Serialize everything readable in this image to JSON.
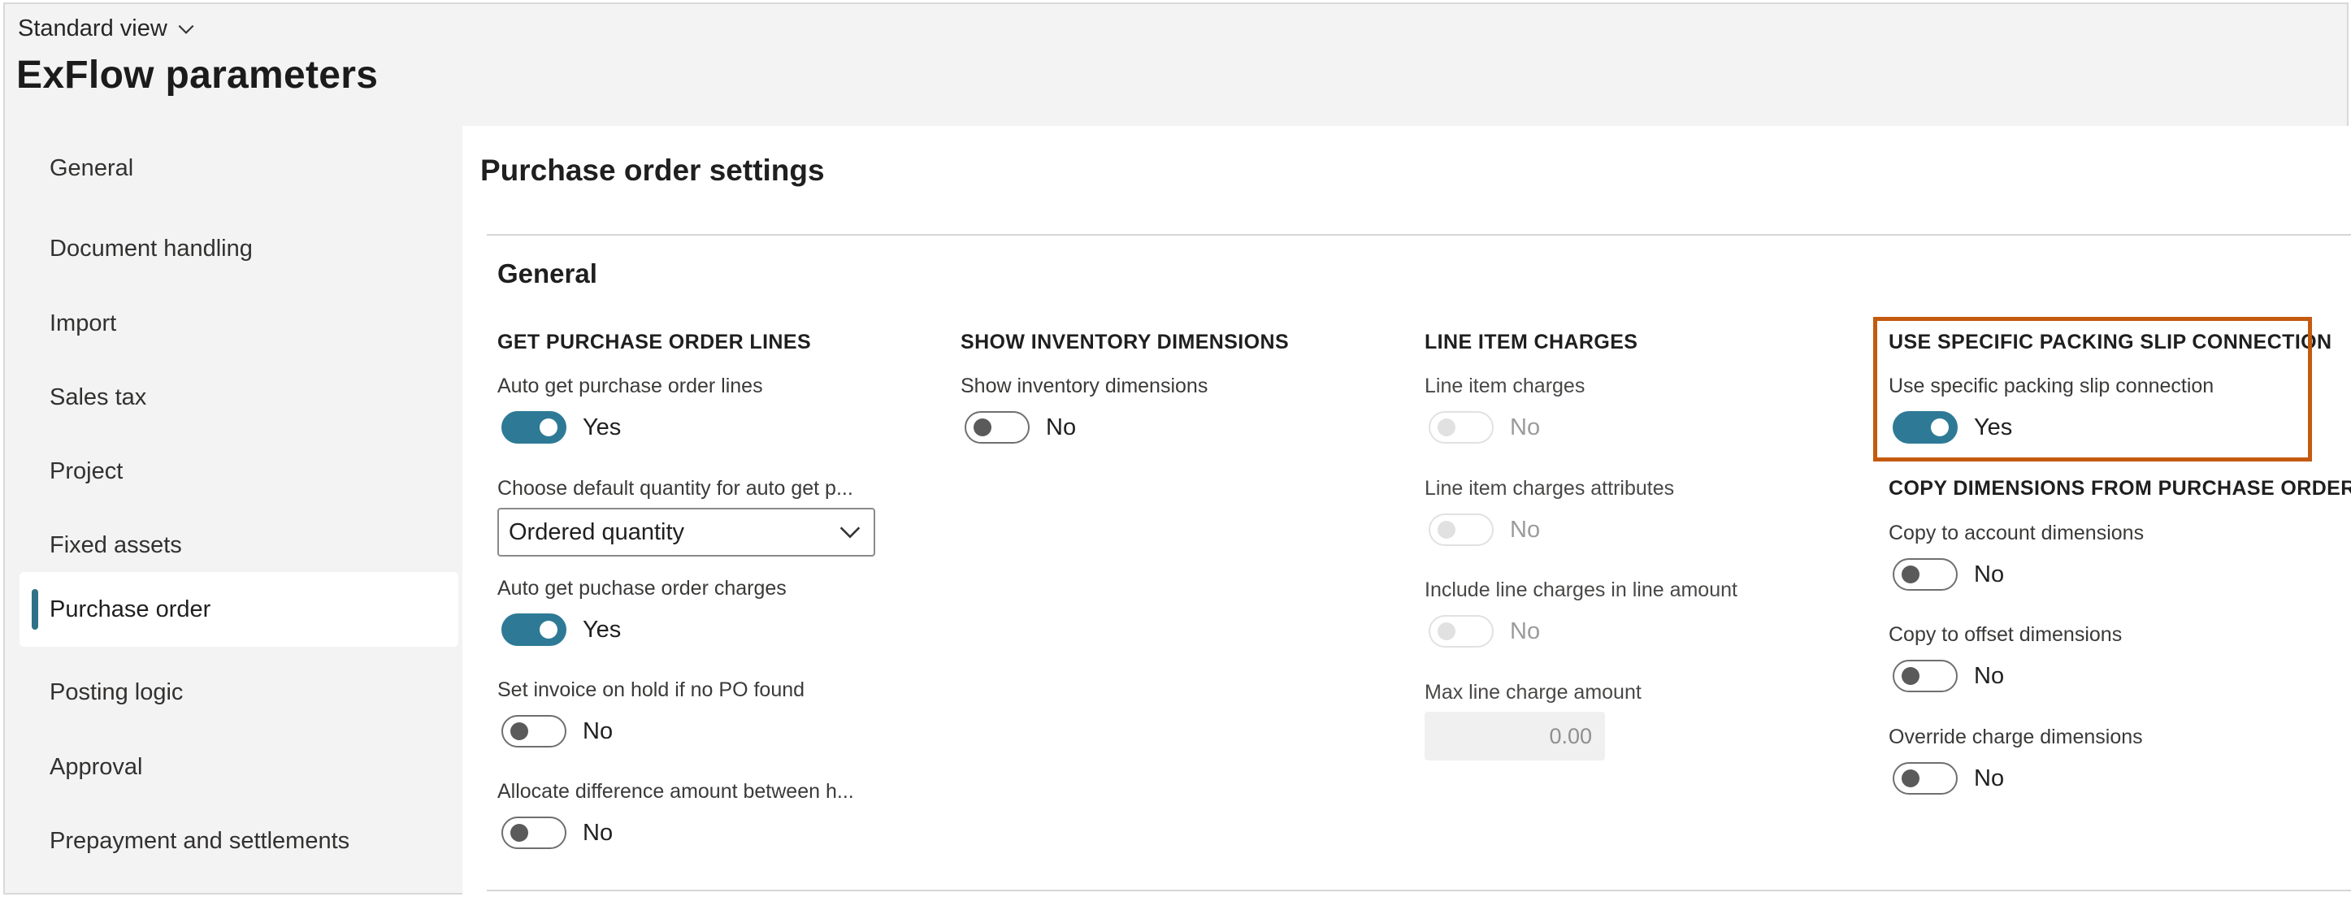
{
  "header": {
    "view_label": "Standard view",
    "page_title": "ExFlow parameters"
  },
  "sidebar": {
    "items": [
      {
        "label": "General"
      },
      {
        "label": "Document handling"
      },
      {
        "label": "Import"
      },
      {
        "label": "Sales tax"
      },
      {
        "label": "Project"
      },
      {
        "label": "Fixed assets"
      },
      {
        "label": "Purchase order"
      },
      {
        "label": "Posting logic"
      },
      {
        "label": "Approval"
      },
      {
        "label": "Prepayment and settlements"
      }
    ],
    "active_index": 6
  },
  "main": {
    "section_title": "Purchase order settings",
    "group_title": "General",
    "col1": {
      "heading": "GET PURCHASE ORDER LINES",
      "auto_get_lines_label": "Auto get purchase order lines",
      "auto_get_lines_value": "Yes",
      "default_qty_label": "Choose default quantity for auto get p...",
      "default_qty_value": "Ordered quantity",
      "auto_get_charges_label": "Auto get puchase order charges",
      "auto_get_charges_value": "Yes",
      "hold_label": "Set invoice on hold if no PO found",
      "hold_value": "No",
      "allocate_label": "Allocate difference amount between h...",
      "allocate_value": "No"
    },
    "col2": {
      "heading": "SHOW INVENTORY DIMENSIONS",
      "show_dims_label": "Show inventory dimensions",
      "show_dims_value": "No"
    },
    "col3": {
      "heading": "LINE ITEM CHARGES",
      "charges_label": "Line item charges",
      "charges_value": "No",
      "charges_attr_label": "Line item charges attributes",
      "charges_attr_value": "No",
      "include_label": "Include line charges in line amount",
      "include_value": "No",
      "max_label": "Max line charge amount",
      "max_value": "0.00"
    },
    "col4": {
      "heading": "USE SPECIFIC PACKING SLIP CONNECTION",
      "packing_label": "Use specific packing slip connection",
      "packing_value": "Yes",
      "copy_heading": "COPY DIMENSIONS FROM PURCHASE ORDER",
      "copy_account_label": "Copy to account dimensions",
      "copy_account_value": "No",
      "copy_offset_label": "Copy to offset dimensions",
      "copy_offset_value": "No",
      "override_label": "Override charge dimensions",
      "override_value": "No"
    }
  },
  "colors": {
    "accent": "#2e7a96",
    "highlight": "#c45a10"
  },
  "icons": {
    "view_chevron": "chevron-down-icon",
    "dropdown_chevron": "chevron-down-icon"
  }
}
